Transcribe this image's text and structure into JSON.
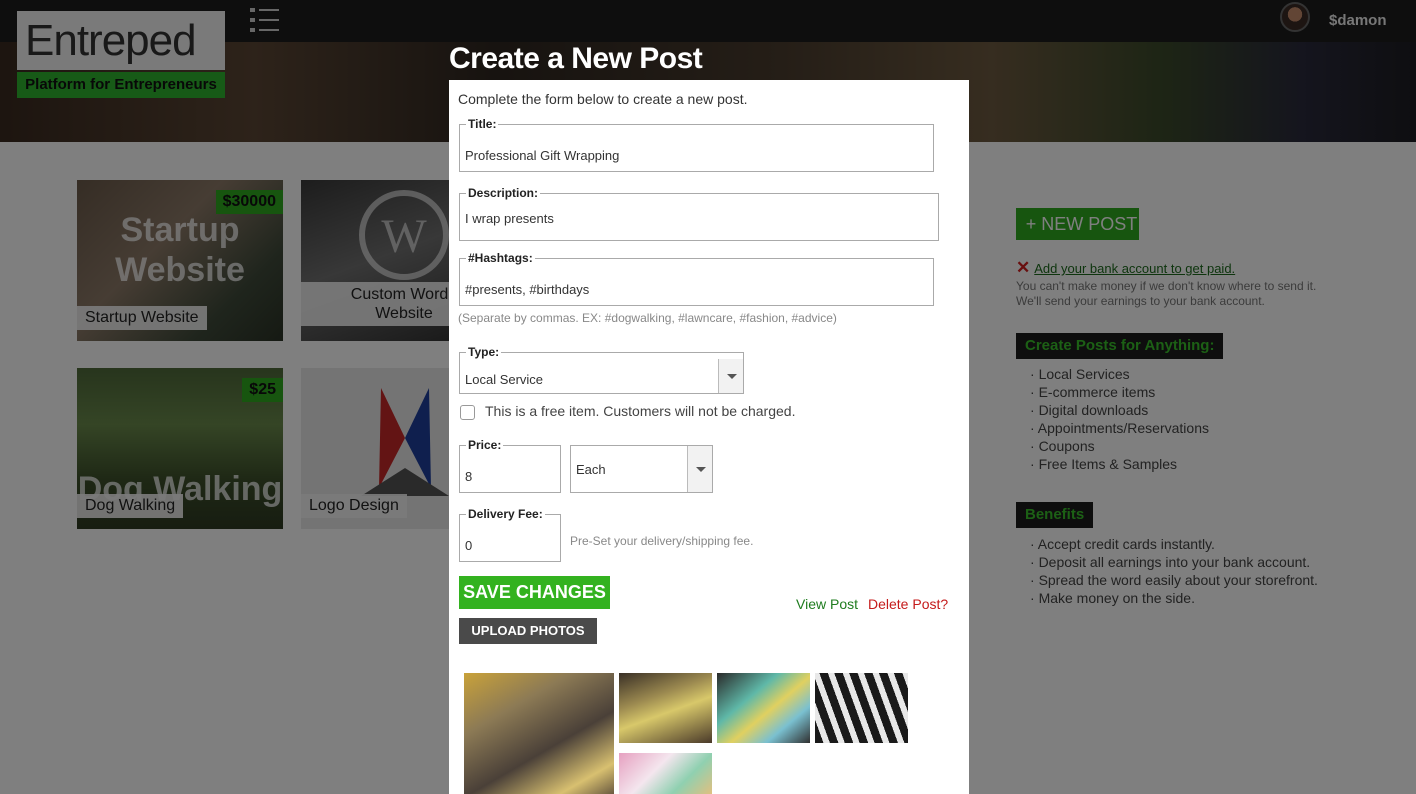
{
  "app": {
    "logo_word": "Entreped",
    "logo_tagline": "Platform for Entrepreneurs",
    "username": "$damon"
  },
  "cards": [
    {
      "title": "Startup Website",
      "price": "$30000",
      "big_text": "Startup Website"
    },
    {
      "title": "Custom Wordp",
      "subtitle": "Website",
      "price": ""
    },
    {
      "title": "Dog Walking",
      "price": "$25",
      "big_text": "Dog Walking"
    },
    {
      "title": "Logo Design",
      "price": ""
    }
  ],
  "sidebar": {
    "new_post_label": "+ NEW POST",
    "bank_link": "Add your bank account to get paid.",
    "bank_note_1": "You can't make money if we don't know where to send it.",
    "bank_note_2": "We'll send your earnings to your bank account.",
    "create_heading": "Create Posts for Anything:",
    "create_items": [
      "Local Services",
      "E-commerce items",
      "Digital downloads",
      "Appointments/Reservations",
      "Coupons",
      "Free Items & Samples"
    ],
    "benefits_heading": "Benefits",
    "benefits_items": [
      "Accept credit cards instantly.",
      "Deposit all earnings into your bank account.",
      "Spread the word easily about your storefront.",
      "Make money on the side."
    ]
  },
  "modal": {
    "title": "Create a New Post",
    "intro": "Complete the form below to create a new post.",
    "title_label": "Title:",
    "title_value": "Professional Gift Wrapping",
    "description_label": "Description:",
    "description_value": "I wrap presents",
    "hashtags_label": "#Hashtags:",
    "hashtags_value": "#presents, #birthdays",
    "hashtags_hint": "(Separate by commas. EX: #dogwalking, #lawncare, #fashion, #advice)",
    "type_label": "Type:",
    "type_value": "Local Service",
    "free_item_label": "This is a free item. Customers will not be charged.",
    "price_label": "Price:",
    "price_value": "8",
    "unit_value": "Each",
    "delivery_label": "Delivery Fee:",
    "delivery_value": "0",
    "delivery_hint": "Pre-Set your delivery/shipping fee.",
    "save_label": "SAVE CHANGES",
    "upload_label": "UPLOAD PHOTOS",
    "view_label": "View Post",
    "delete_label": "Delete Post?"
  },
  "colors": {
    "brand_green": "#2eaa1f",
    "dark_bar": "#1c1c1c",
    "delete_red": "#c51a1a"
  }
}
